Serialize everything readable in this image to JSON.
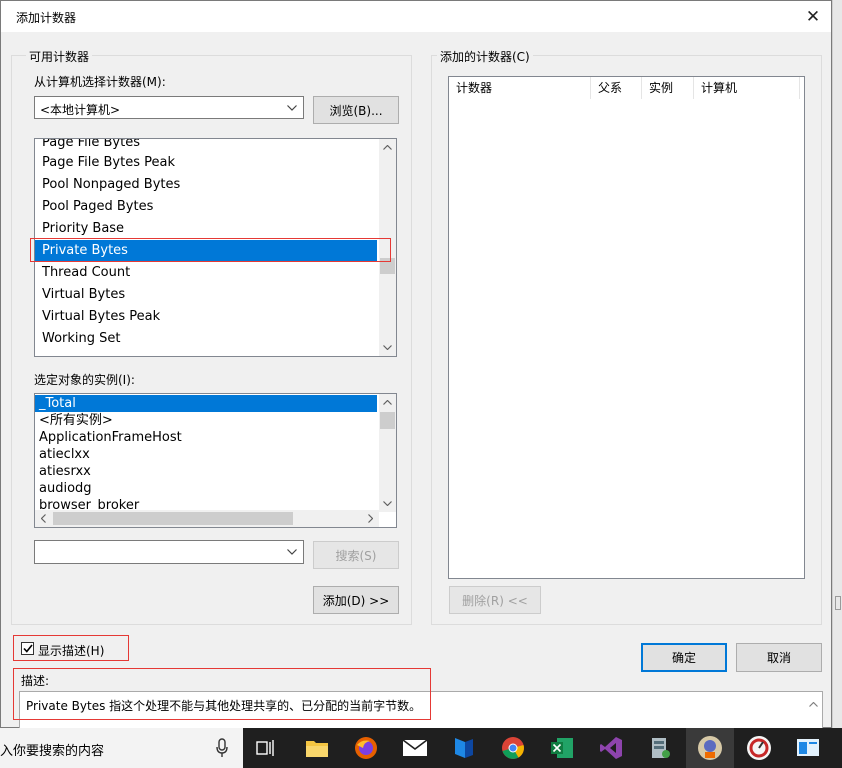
{
  "dialog": {
    "title": "添加计数器",
    "close_glyph": "✕"
  },
  "available": {
    "legend": "可用计数器",
    "select_from_label": "从计算机选择计数器(M):",
    "computer_value": "<本地计算机>",
    "browse_label": "浏览(B)...",
    "counters": [
      "Page File Bytes",
      "Page File Bytes Peak",
      "Pool Nonpaged Bytes",
      "Pool Paged Bytes",
      "Priority Base",
      "Private Bytes",
      "Thread Count",
      "Virtual Bytes",
      "Virtual Bytes Peak",
      "Working Set"
    ],
    "instances_label": "选定对象的实例(I):",
    "instances": [
      "_Total",
      "<所有实例>",
      "ApplicationFrameHost",
      "atieclxx",
      "atiesrxx",
      "audiodg",
      "browser_broker"
    ],
    "search_value": "",
    "search_label": "搜索(S)",
    "add_label": "添加(D) >>"
  },
  "added": {
    "legend": "添加的计数器(C)",
    "columns": [
      "计数器",
      "父系",
      "实例",
      "计算机"
    ],
    "remove_label": "删除(R) <<"
  },
  "footer": {
    "show_description_label": "显示描述(H)",
    "show_description_checked": true,
    "ok_label": "确定",
    "cancel_label": "取消",
    "description_label": "描述:",
    "description_text": "Private Bytes 指这个处理不能与其他处理共享的、已分配的当前字节数。"
  },
  "taskbar": {
    "search_text": "入你要搜索的内容"
  },
  "colors": {
    "selection": "#0078d7",
    "highlight": "#e53935"
  }
}
